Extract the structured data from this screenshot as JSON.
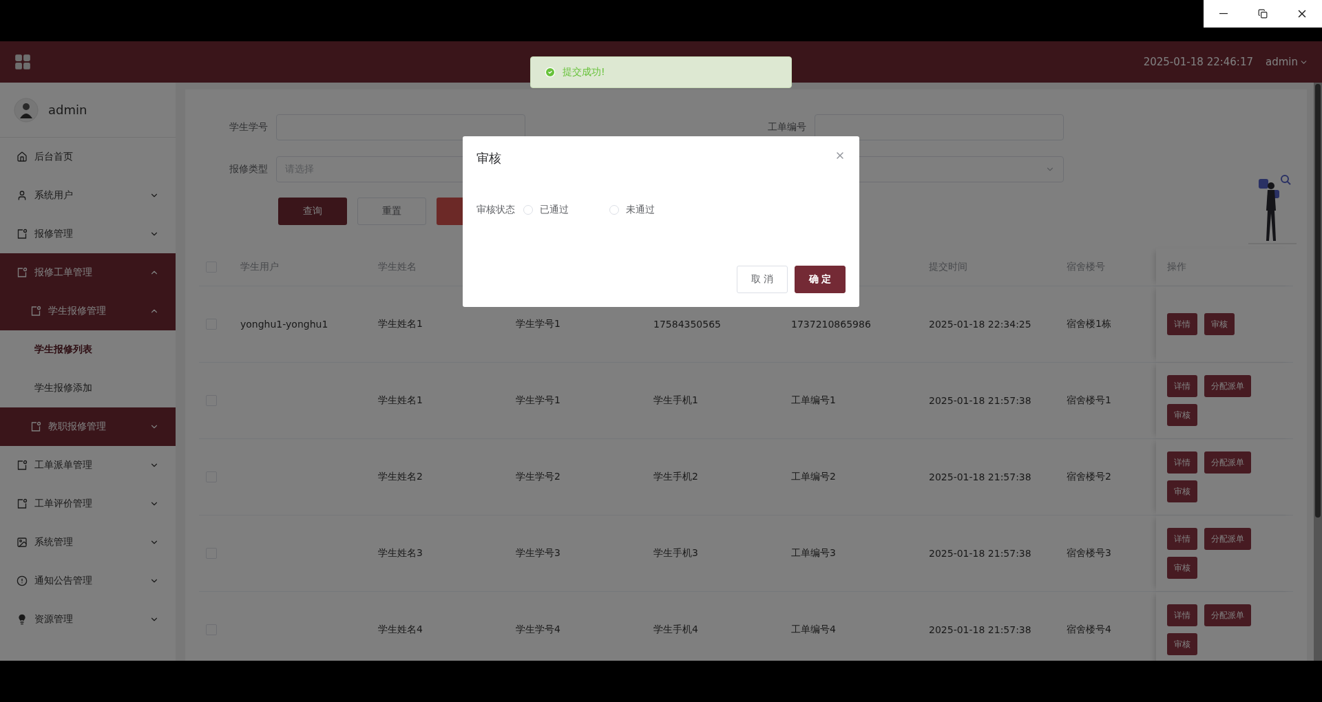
{
  "header": {
    "datetime": "2025-01-18 22:46:17",
    "user": "admin"
  },
  "toast": {
    "message": "提交成功!"
  },
  "sidebar": {
    "user": "admin",
    "items": [
      {
        "label": "后台首页",
        "selected": false
      },
      {
        "label": "系统用户",
        "selected": false,
        "expanded": false
      },
      {
        "label": "报修管理",
        "selected": false,
        "expanded": false
      },
      {
        "label": "报修工单管理",
        "selected": false,
        "expanded": true,
        "children": [
          {
            "label": "学生报修管理",
            "selected": false,
            "expanded": true,
            "children": [
              {
                "label": "学生报修列表",
                "selected": true
              },
              {
                "label": "学生报修添加",
                "selected": false
              }
            ]
          },
          {
            "label": "教职报修管理",
            "selected": false,
            "expanded": false
          }
        ]
      },
      {
        "label": "工单派单管理",
        "selected": false,
        "expanded": false
      },
      {
        "label": "工单评价管理",
        "selected": false,
        "expanded": false
      },
      {
        "label": "系统管理",
        "selected": false,
        "expanded": false
      },
      {
        "label": "通知公告管理",
        "selected": false,
        "expanded": false
      },
      {
        "label": "资源管理",
        "selected": false,
        "expanded": false
      }
    ]
  },
  "filters": [
    {
      "label": "学生学号",
      "kind": "input"
    },
    {
      "label": "工单编号",
      "kind": "input"
    },
    {
      "label": "报修类型",
      "kind": "select",
      "placeholder": "请选择"
    },
    {
      "kind": "select"
    }
  ],
  "buttons": [
    {
      "label": "查询",
      "kind": "primary"
    },
    {
      "label": "重置",
      "kind": "default"
    },
    {
      "kind": "danger"
    }
  ],
  "table": {
    "select_all_checked": false,
    "headers_left": [
      "学生用户",
      "学生姓名"
    ],
    "headers_right": [
      "提交时间",
      "宿舍楼号"
    ],
    "action_header": "操作",
    "rows": [
      {
        "checked": false,
        "user": "yonghu1-yonghu1",
        "cells": [
          "学生姓名1",
          "学生学号1",
          "17584350565",
          "1737210865986",
          "2025-01-18 22:34:25",
          "宿舍楼1栋"
        ],
        "actions": [
          "详情",
          "审核"
        ]
      },
      {
        "checked": false,
        "cells": [
          "学生姓名1",
          "学生学号1",
          "学生手机1",
          "工单编号1",
          "2025-01-18 21:57:38",
          "宿舍楼号1"
        ],
        "actions": [
          "详情",
          "分配派单",
          "审核"
        ]
      },
      {
        "checked": false,
        "cells": [
          "学生姓名2",
          "学生学号2",
          "学生手机2",
          "工单编号2",
          "2025-01-18 21:57:38",
          "宿舍楼号2"
        ],
        "actions": [
          "详情",
          "分配派单",
          "审核"
        ]
      },
      {
        "checked": false,
        "cells": [
          "学生姓名3",
          "学生学号3",
          "学生手机3",
          "工单编号3",
          "2025-01-18 21:57:38",
          "宿舍楼号3"
        ],
        "actions": [
          "详情",
          "分配派单",
          "审核"
        ]
      },
      {
        "checked": false,
        "cells": [
          "学生姓名4",
          "学生学号4",
          "学生手机4",
          "工单编号4",
          "2025-01-18 21:57:38",
          "宿舍楼号4"
        ],
        "actions": [
          "详情",
          "分配派单",
          "审核"
        ]
      }
    ]
  },
  "dialog": {
    "title": "审核",
    "field_label": "审核状态",
    "options": [
      {
        "label": "已通过",
        "selected": false
      },
      {
        "label": "未通过",
        "selected": false
      }
    ],
    "buttons": [
      {
        "label": "取 消",
        "kind": "default"
      },
      {
        "label": "确 定",
        "kind": "primary"
      }
    ]
  }
}
